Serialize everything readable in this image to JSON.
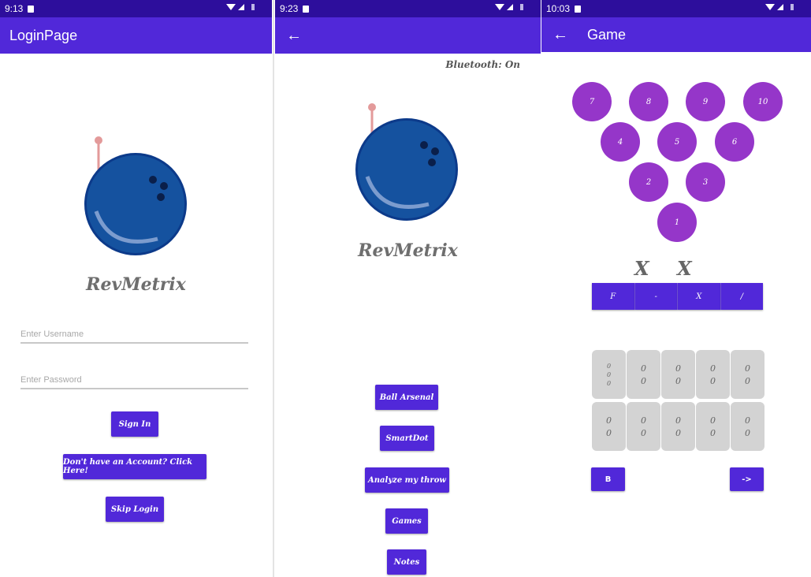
{
  "screens": {
    "login": {
      "status_time": "9:13",
      "title": "LoginPage",
      "brand": "RevMetrix",
      "username_placeholder": "Enter Username",
      "password_placeholder": "Enter Password",
      "sign_in_label": "Sign In",
      "register_label": "Don't have an Account? Click Here!",
      "skip_label": "Skip Login"
    },
    "menu": {
      "status_time": "9:23",
      "bluetooth_status": "Bluetooth: On",
      "brand": "RevMetrix",
      "buttons": [
        "Ball Arsenal",
        "SmartDot",
        "Analyze my throw",
        "Games",
        "Notes"
      ]
    },
    "game": {
      "status_time": "10:03",
      "title": "Game",
      "pins": [
        "7",
        "8",
        "9",
        "10",
        "4",
        "5",
        "6",
        "2",
        "3",
        "1"
      ],
      "marks": [
        "X",
        "X"
      ],
      "frame_buttons": [
        "F",
        "-",
        "X",
        "/"
      ],
      "first_cell": [
        "0",
        "0",
        "0"
      ],
      "scores_top": [
        [
          "0",
          "0"
        ],
        [
          "0",
          "0"
        ],
        [
          "0",
          "0"
        ],
        [
          "0",
          "0"
        ]
      ],
      "scores_bottom": [
        [
          "0",
          "0"
        ],
        [
          "0",
          "0"
        ],
        [
          "0",
          "0"
        ],
        [
          "0",
          "0"
        ],
        [
          "0",
          "0"
        ]
      ],
      "back_label": "B",
      "next_label": "->"
    }
  },
  "colors": {
    "status_bar": "#2d0e9c",
    "app_bar": "#5128d9",
    "button": "#5128d9",
    "pin": "#9536c9",
    "score_cell": "#d3d3d3"
  },
  "icons": [
    "back-arrow-icon",
    "wifi-icon",
    "signal-icon",
    "battery-icon",
    "sd-card-icon",
    "bowling-ball-logo"
  ]
}
